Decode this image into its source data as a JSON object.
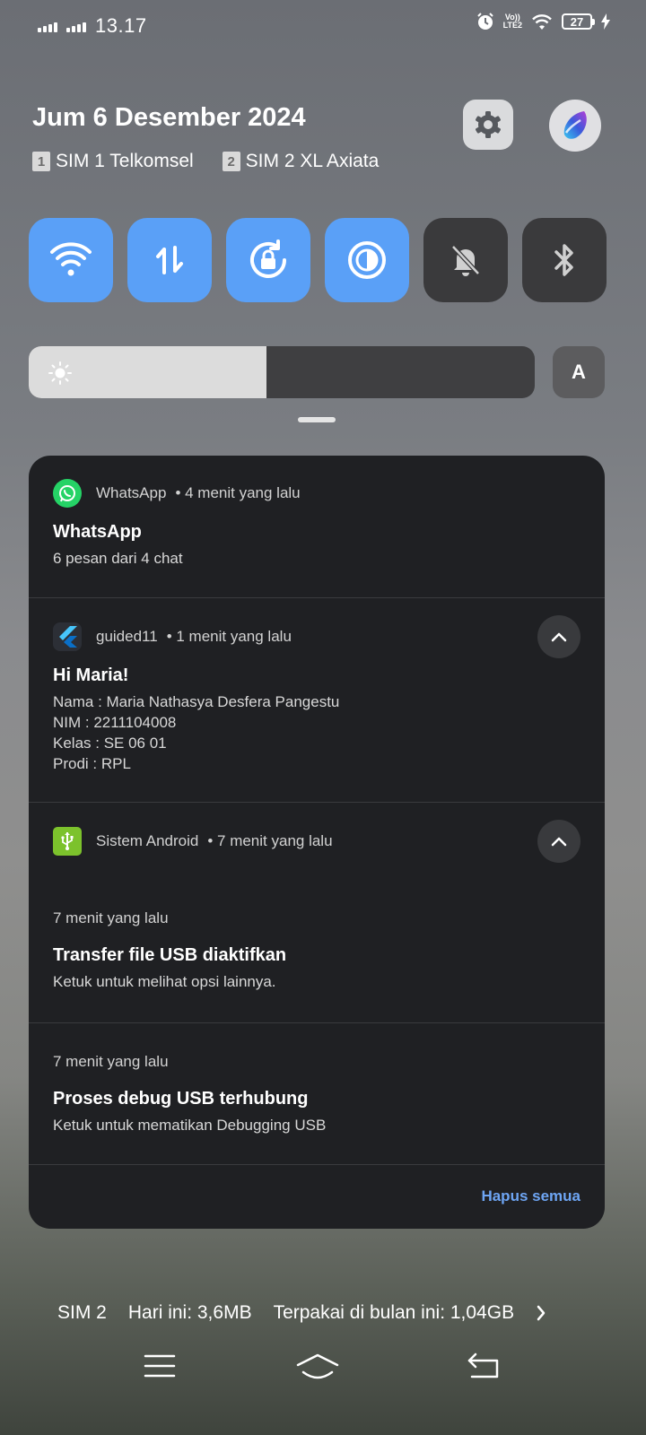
{
  "status_bar": {
    "time": "13.17",
    "volte_top": "Vo))",
    "volte_bottom": "LTE2",
    "battery_level": "27",
    "icons": [
      "signal-icon-1",
      "signal-icon-2",
      "alarm-icon",
      "wifi-icon",
      "battery-icon",
      "charging-icon"
    ]
  },
  "header": {
    "date": "Jum 6 Desember 2024",
    "sim1_num": "1",
    "sim1_label": "SIM 1 Telkomsel",
    "sim2_num": "2",
    "sim2_label": "SIM 2 XL Axiata"
  },
  "quick_tiles": [
    {
      "name": "wifi",
      "state": "on"
    },
    {
      "name": "mobile-data",
      "state": "on"
    },
    {
      "name": "rotation-lock",
      "state": "on"
    },
    {
      "name": "dark-mode",
      "state": "on"
    },
    {
      "name": "silent",
      "state": "off"
    },
    {
      "name": "bluetooth",
      "state": "off"
    }
  ],
  "brightness": {
    "level": 0.47,
    "auto_label": "A"
  },
  "notifications": {
    "whatsapp": {
      "app": "WhatsApp",
      "time": "• 4 menit yang lalu",
      "title": "WhatsApp",
      "body": "6 pesan dari 4 chat"
    },
    "guided": {
      "app": "guided11",
      "time": "• 1 menit yang lalu",
      "title": "Hi Maria!",
      "lines": [
        "Nama : Maria Nathasya Desfera Pangestu",
        "NIM : 2211104008",
        "Kelas : SE 06 01",
        "Prodi : RPL"
      ]
    },
    "android": {
      "app": "Sistem Android",
      "time": "• 7 menit yang lalu",
      "items": [
        {
          "time": "7 menit yang lalu",
          "title": "Transfer file USB diaktifkan",
          "body": "Ketuk untuk melihat opsi lainnya."
        },
        {
          "time": "7 menit yang lalu",
          "title": "Proses debug USB terhubung",
          "body": "Ketuk untuk mematikan Debugging USB"
        }
      ]
    },
    "clear_all": "Hapus semua"
  },
  "data_usage": {
    "sim": "SIM 2",
    "today": "Hari ini: 3,6MB",
    "month": "Terpakai di bulan ini: 1,04GB"
  },
  "colors": {
    "accent": "#5aa0f7",
    "panel": "#1f2023",
    "link": "#6ea5f3",
    "whatsapp": "#25d366",
    "android": "#7cc22c"
  }
}
